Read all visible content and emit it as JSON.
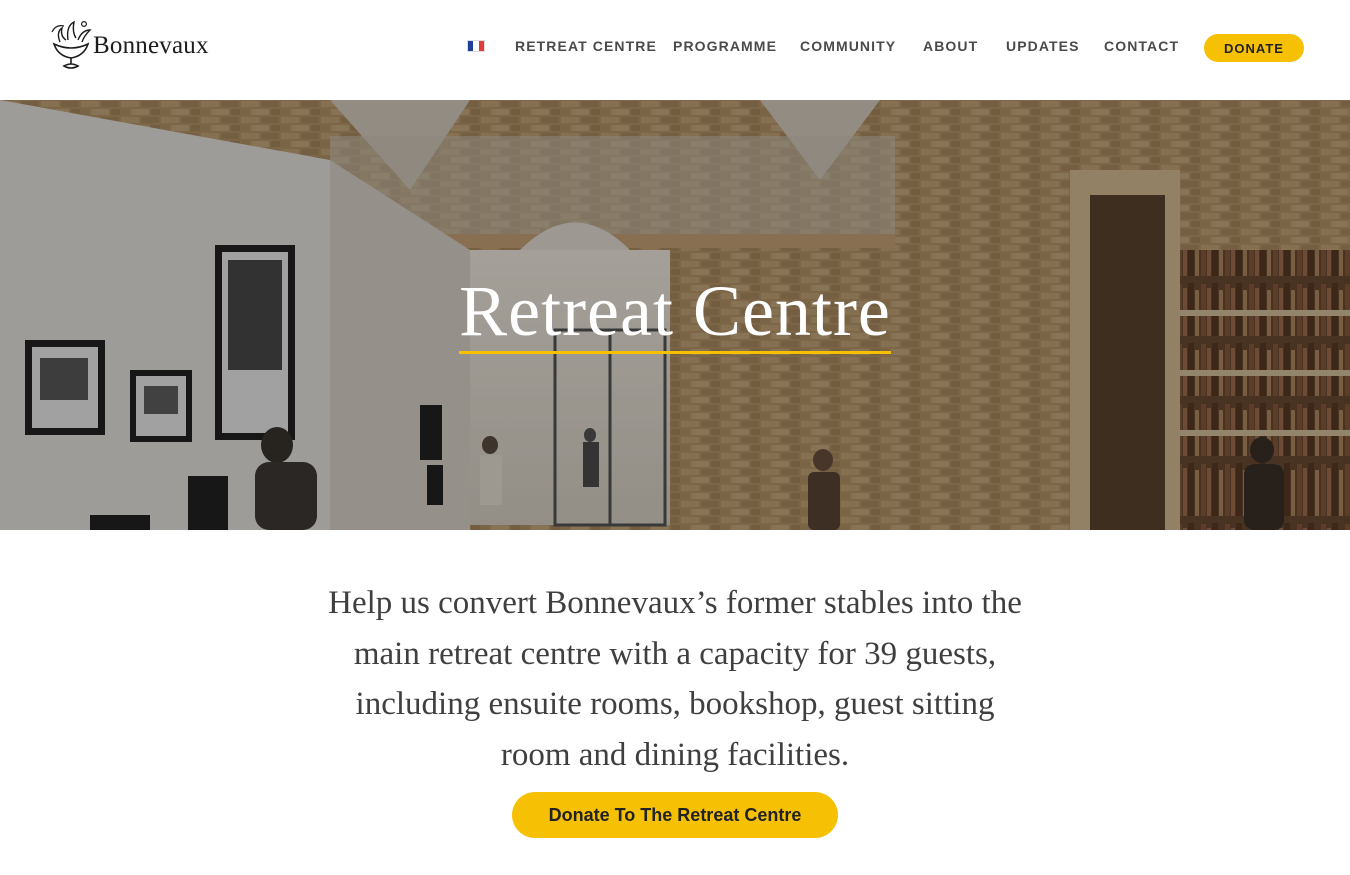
{
  "header": {
    "logo_text": "Bonnevaux",
    "language_flag": "flag-fr-icon",
    "nav": [
      {
        "label": "RETREAT CENTRE"
      },
      {
        "label": "PROGRAMME"
      },
      {
        "label": "COMMUNITY"
      },
      {
        "label": "ABOUT"
      },
      {
        "label": "UPDATES"
      },
      {
        "label": "CONTACT"
      }
    ],
    "donate_label": "DONATE"
  },
  "hero": {
    "title": "Retreat Centre"
  },
  "main": {
    "intro": "Help us convert Bonnevaux’s former stables into the main retreat centre with a capacity for 39 guests, including ensuite rooms, bookshop, guest sitting room and dining facilities.",
    "cta_label": "Donate To The Retreat Centre"
  },
  "colors": {
    "accent": "#f6c105",
    "nav_text": "#4a4a4a",
    "body_text": "#3f3f3f",
    "flag_blue": "#1f3f9a",
    "flag_white": "#ffffff",
    "flag_red": "#e23b3b"
  }
}
